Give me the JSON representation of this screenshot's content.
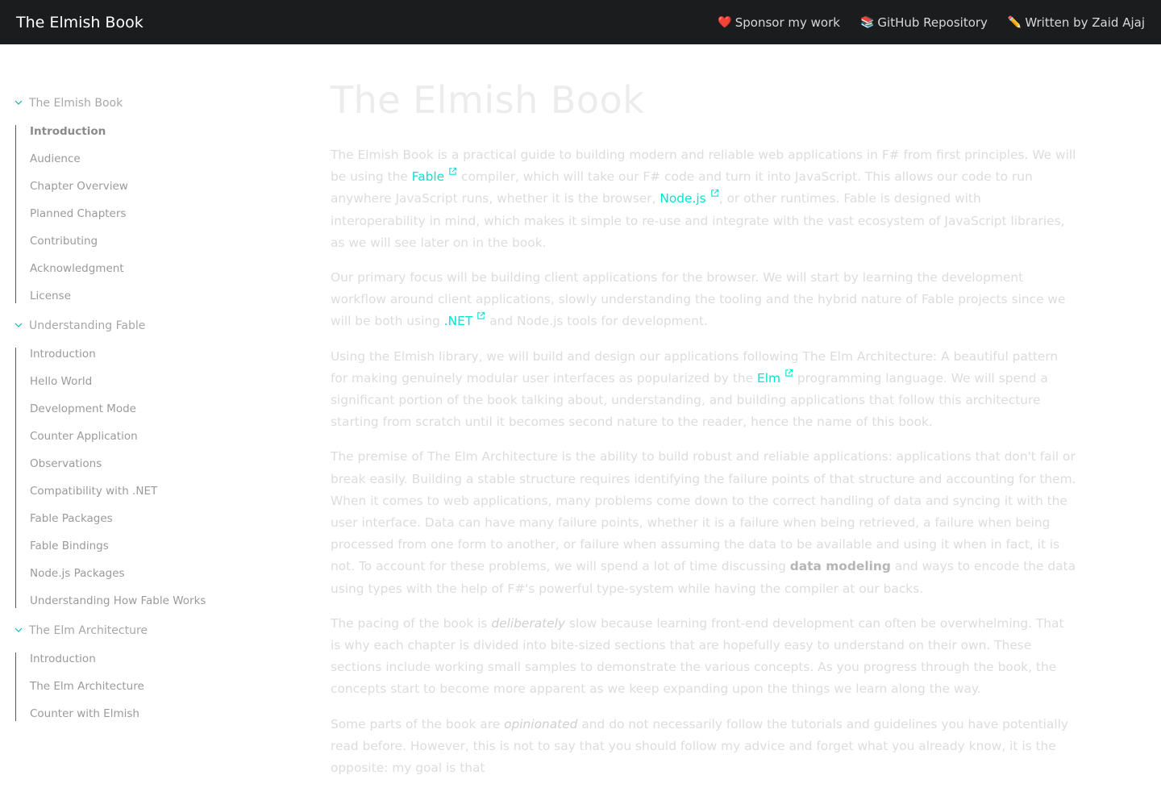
{
  "navbar": {
    "brand": "The Elmish Book",
    "links": [
      {
        "emoji": "❤️",
        "label": "Sponsor my work"
      },
      {
        "emoji": "📚",
        "label": "GitHub Repository"
      },
      {
        "emoji": "✏️",
        "label": "Written by Zaid Ajaj"
      }
    ]
  },
  "sidebar": {
    "sections": [
      {
        "title": "The Elmish Book",
        "items": [
          "Introduction",
          "Audience",
          "Chapter Overview",
          "Planned Chapters",
          "Contributing",
          "Acknowledgment",
          "License"
        ]
      },
      {
        "title": "Understanding Fable",
        "items": [
          "Introduction",
          "Hello World",
          "Development Mode",
          "Counter Application",
          "Observations",
          "Compatibility with .NET",
          "Fable Packages",
          "Fable Bindings",
          "Node.js Packages",
          "Understanding How Fable Works"
        ]
      },
      {
        "title": "The Elm Architecture",
        "items": [
          "Introduction",
          "The Elm Architecture",
          "Counter with Elmish"
        ]
      }
    ]
  },
  "main": {
    "title": "The Elmish Book",
    "p1": {
      "a": "The Elmish Book is a practical guide to building modern and reliable web applications in F# from first principles. We will be using the ",
      "link1": "Fable",
      "b": " compiler, which will take our F# code and turn it into JavaScript. This allows our code to run anywhere JavaScript runs, whether it is the browser, ",
      "link2": "Node.js",
      "c": ", or other runtimes. Fable is designed with interoperability in mind, which makes it simple to re-use and integrate with the vast ecosystem of JavaScript libraries, as we will see later on in the book."
    },
    "p2": {
      "a": "Our primary focus will be building client applications for the browser. We will start by learning the development workflow around client applications, slowly understanding the tooling and the hybrid nature of Fable projects since we will be both using ",
      "link1": ".NET",
      "b": " and Node.js tools for development."
    },
    "p3": {
      "a": "Using the Elmish library, we will build and design our applications following The Elm Architecture: A beautiful pattern for making genuinely modular user interfaces as popularized by the ",
      "link1": "Elm",
      "b": " programming language. We will spend a significant portion of the book talking about, understanding, and building applications that follow this architecture starting from scratch until it becomes second nature to the reader, hence the name of this book."
    },
    "p4": {
      "a": "The premise of The Elm Architecture is the ability to build robust and reliable applications: applications that don't fail or break easily. Building a stable structure requires identifying the failure points of that structure and accounting for them. When it comes to web applications, many problems come down to the correct handling of data and syncing it with the user interface. Data can have many failure points, whether it is a failure when being retrieved, a failure when being processed from one form to another, or failure when assuming the data to be available and using it when in fact, it is not. To account for these problems, we will spend a lot of time discussing ",
      "bold": "data modeling",
      "b": " and ways to encode the data using types with the help of F#'s powerful type-system while having the compiler at our backs."
    },
    "p5": {
      "a": "The pacing of the book is ",
      "em": "deliberately",
      "b": " slow because learning front-end development can often be overwhelming. That is why each chapter is divided into bite-sized sections that are hopefully easy to understand on their own. These sections include working small samples to demonstrate the various concepts. As you progress through the book, the concepts start to become more apparent as we keep expanding upon the things we learn along the way."
    },
    "p6": {
      "a": "Some parts of the book are ",
      "em": "opinionated",
      "b": " and do not necessarily follow the tutorials and guidelines you have potentially read before. However, this is not to say that you should follow my advice and forget what you already know, it is the opposite: my goal is that"
    }
  },
  "colors": {
    "navbar_bg": "#1b1c1e",
    "link": "#00e5d2",
    "body_text": "#dcdcdc"
  },
  "icons": {
    "chevron": "chevron-down-icon",
    "external": "external-link-icon",
    "sponsor": "heart-icon",
    "github": "books-icon",
    "author": "pencil-icon"
  }
}
